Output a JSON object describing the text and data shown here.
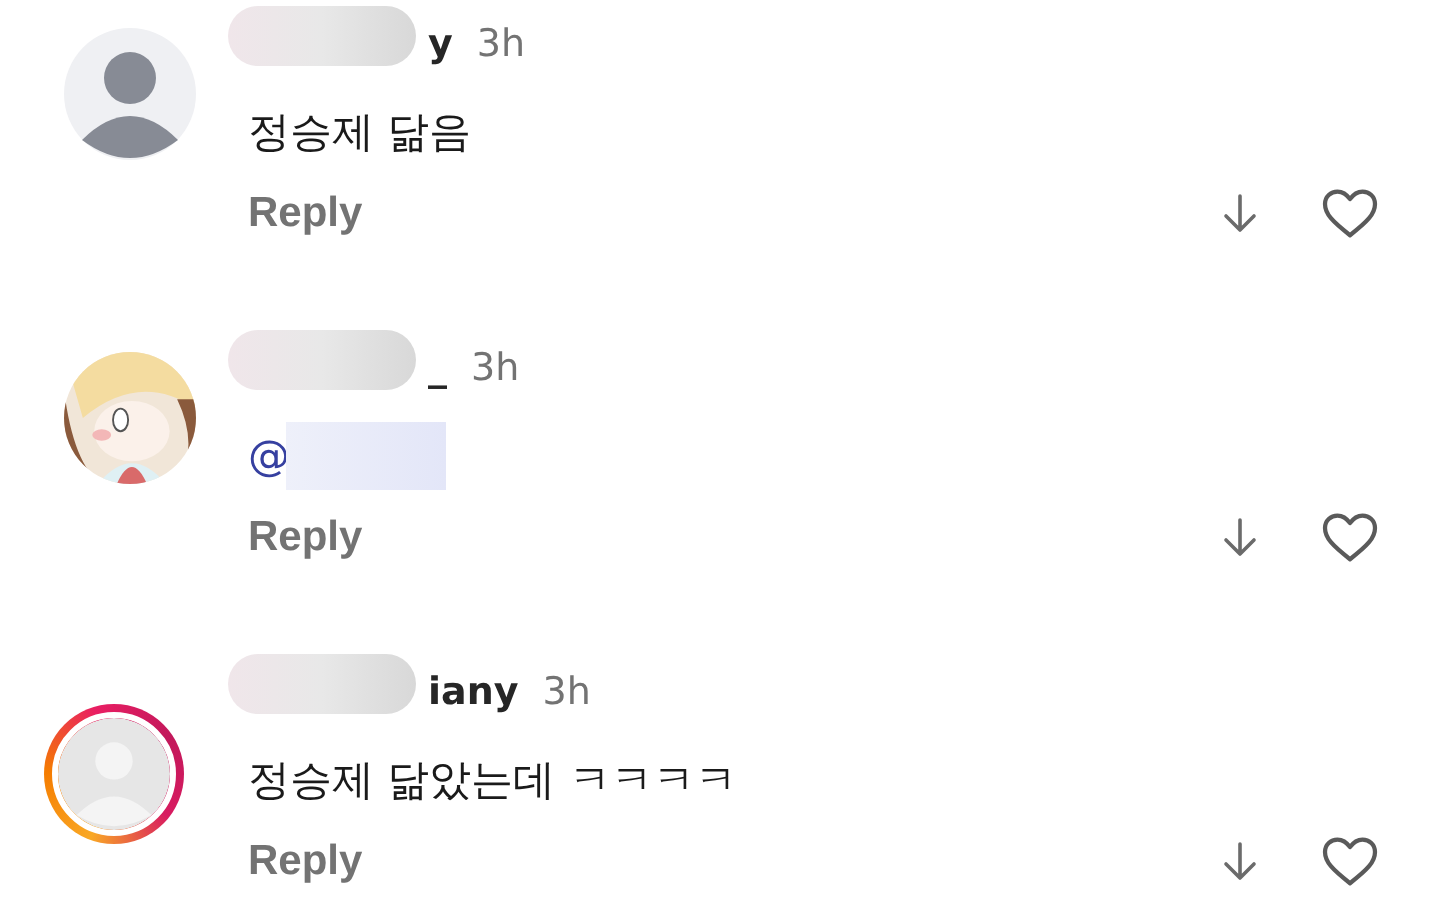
{
  "comments": [
    {
      "avatar": {
        "kind": "default",
        "story_ring": false
      },
      "username": "y",
      "time": "3h",
      "body": {
        "kind": "text",
        "text": "정승제 닮음"
      },
      "reply": "Reply"
    },
    {
      "username": "_",
      "time": "3h",
      "body": {
        "kind": "mention",
        "text": "@"
      },
      "reply": "Reply"
    },
    {
      "avatar": {
        "kind": "default",
        "story_ring": true
      },
      "username": "iany",
      "time": "3h",
      "body": {
        "kind": "text",
        "text": "정승제 닮았는데 ㅋㅋㅋㅋ"
      },
      "reply": "Reply"
    }
  ]
}
